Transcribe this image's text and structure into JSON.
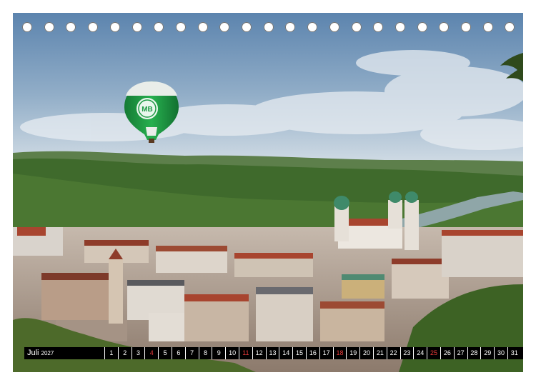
{
  "calendar": {
    "month": "Juli",
    "year": "2027",
    "days": [
      {
        "n": "1",
        "red": false
      },
      {
        "n": "2",
        "red": false
      },
      {
        "n": "3",
        "red": false
      },
      {
        "n": "4",
        "red": true
      },
      {
        "n": "5",
        "red": false
      },
      {
        "n": "6",
        "red": false
      },
      {
        "n": "7",
        "red": false
      },
      {
        "n": "8",
        "red": false
      },
      {
        "n": "9",
        "red": false
      },
      {
        "n": "10",
        "red": false
      },
      {
        "n": "11",
        "red": true
      },
      {
        "n": "12",
        "red": false
      },
      {
        "n": "13",
        "red": false
      },
      {
        "n": "14",
        "red": false
      },
      {
        "n": "15",
        "red": false
      },
      {
        "n": "16",
        "red": false
      },
      {
        "n": "17",
        "red": false
      },
      {
        "n": "18",
        "red": true
      },
      {
        "n": "19",
        "red": false
      },
      {
        "n": "20",
        "red": false
      },
      {
        "n": "21",
        "red": false
      },
      {
        "n": "22",
        "red": false
      },
      {
        "n": "23",
        "red": false
      },
      {
        "n": "24",
        "red": false
      },
      {
        "n": "25",
        "red": true
      },
      {
        "n": "26",
        "red": false
      },
      {
        "n": "27",
        "red": false
      },
      {
        "n": "28",
        "red": false
      },
      {
        "n": "29",
        "red": false
      },
      {
        "n": "30",
        "red": false
      },
      {
        "n": "31",
        "red": false
      }
    ]
  },
  "photo": {
    "balloon_logo_text": "MB",
    "colors": {
      "sky_top": "#5f86b0",
      "sky_bottom": "#c9d6e2",
      "balloon_green": "#1e9a45",
      "river": "#8fa6a8",
      "forest": "#3f6a2c",
      "roof_red": "#a8452f"
    }
  },
  "binding_holes": 23
}
